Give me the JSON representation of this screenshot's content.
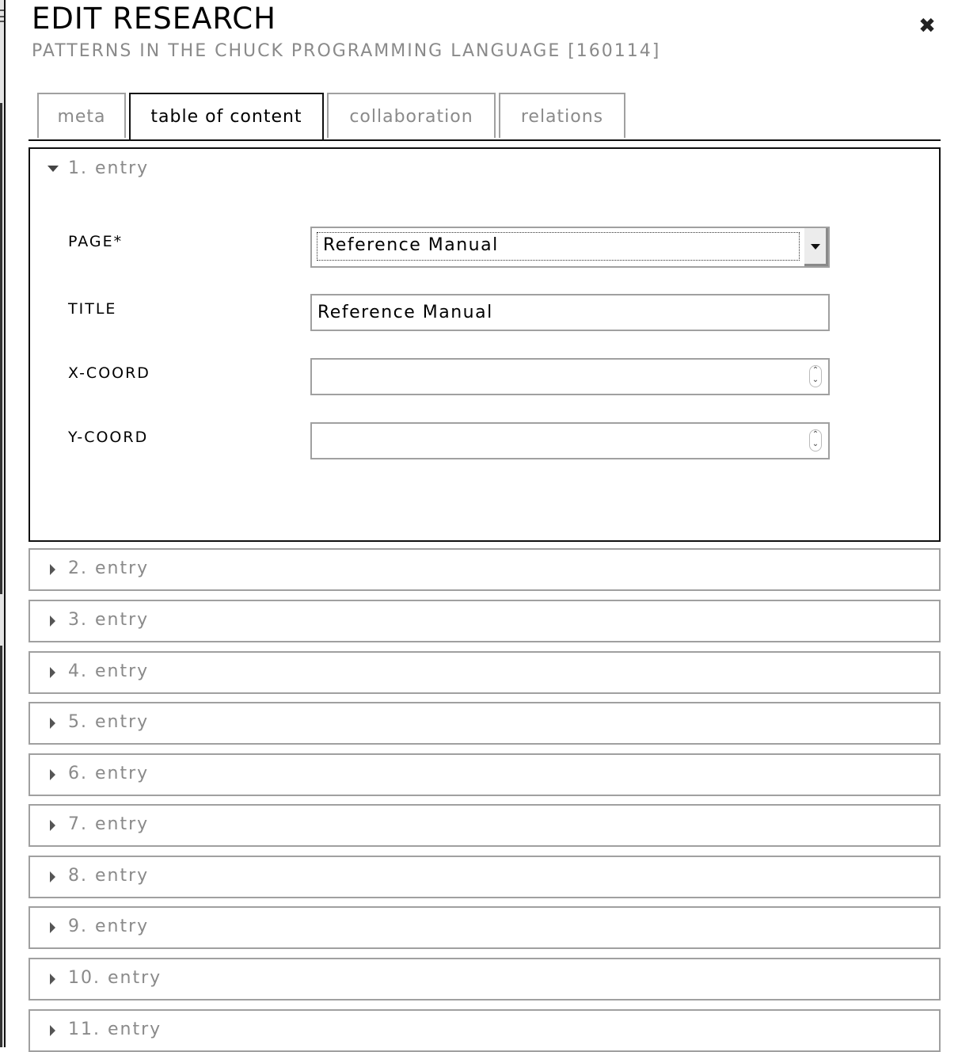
{
  "dialog": {
    "title": "EDIT RESEARCH",
    "subtitle": "PATTERNS IN THE CHUCK PROGRAMMING LANGUAGE [160114]",
    "close_icon": "close-x-icon"
  },
  "tabs": [
    {
      "label": "meta",
      "active": false
    },
    {
      "label": "table of content",
      "active": true
    },
    {
      "label": "collaboration",
      "active": false
    },
    {
      "label": "relations",
      "active": false
    }
  ],
  "entries": [
    {
      "label": "1. entry",
      "expanded": true,
      "fields": {
        "page": {
          "label": "PAGE*",
          "value": "Reference Manual"
        },
        "title": {
          "label": "TITLE",
          "value": "Reference Manual"
        },
        "x_coord": {
          "label": "X-COORD",
          "value": ""
        },
        "y_coord": {
          "label": "Y-COORD",
          "value": ""
        }
      }
    },
    {
      "label": "2. entry",
      "expanded": false
    },
    {
      "label": "3. entry",
      "expanded": false
    },
    {
      "label": "4. entry",
      "expanded": false
    },
    {
      "label": "5. entry",
      "expanded": false
    },
    {
      "label": "6. entry",
      "expanded": false
    },
    {
      "label": "7. entry",
      "expanded": false
    },
    {
      "label": "8. entry",
      "expanded": false
    },
    {
      "label": "9. entry",
      "expanded": false
    },
    {
      "label": "10. entry",
      "expanded": false
    },
    {
      "label": "11. entry",
      "expanded": false
    }
  ],
  "icons": {
    "expanded": "caret-down-icon",
    "collapsed": "caret-right-icon",
    "select": "dropdown-arrow-icon",
    "spinner": "number-spinner-icon"
  }
}
